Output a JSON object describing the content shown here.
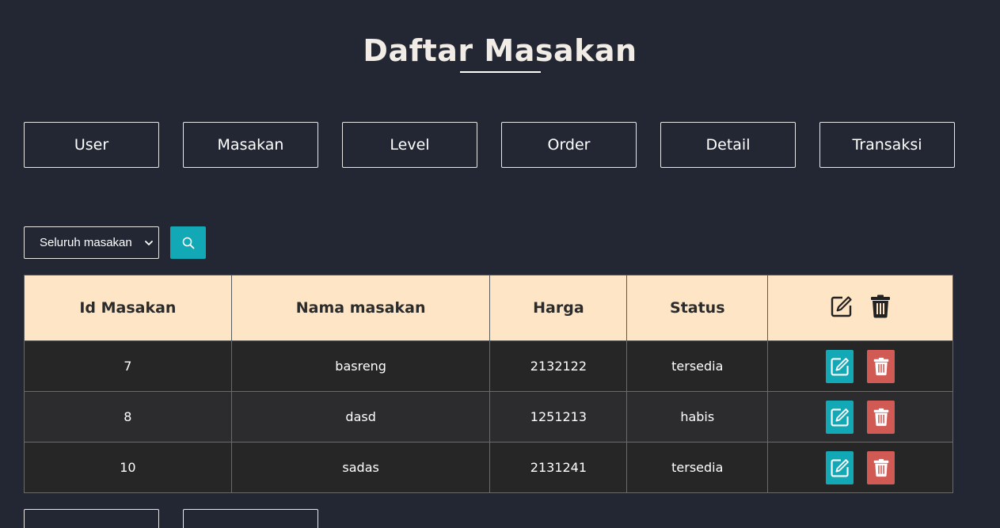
{
  "page": {
    "title": "Daftar Masakan"
  },
  "nav": {
    "items": [
      {
        "label": "User"
      },
      {
        "label": "Masakan"
      },
      {
        "label": "Level"
      },
      {
        "label": "Order"
      },
      {
        "label": "Detail"
      },
      {
        "label": "Transaksi"
      }
    ]
  },
  "filter": {
    "selected": "Seluruh masakan",
    "search_icon": "search-icon"
  },
  "table": {
    "headers": [
      "Id Masakan",
      "Nama masakan",
      "Harga",
      "Status"
    ],
    "header_action_icons": [
      "edit-icon",
      "trash-icon"
    ],
    "rows": [
      {
        "id": "7",
        "nama": "basreng",
        "harga": "2132122",
        "status": "tersedia"
      },
      {
        "id": "8",
        "nama": "dasd",
        "harga": "1251213",
        "status": "habis"
      },
      {
        "id": "10",
        "nama": "sadas",
        "harga": "2131241",
        "status": "tersedia"
      }
    ]
  },
  "colors": {
    "background": "#222733",
    "header_bg": "#fde5c6",
    "edit_button": "#12a8b5",
    "delete_button": "#d25a55"
  }
}
